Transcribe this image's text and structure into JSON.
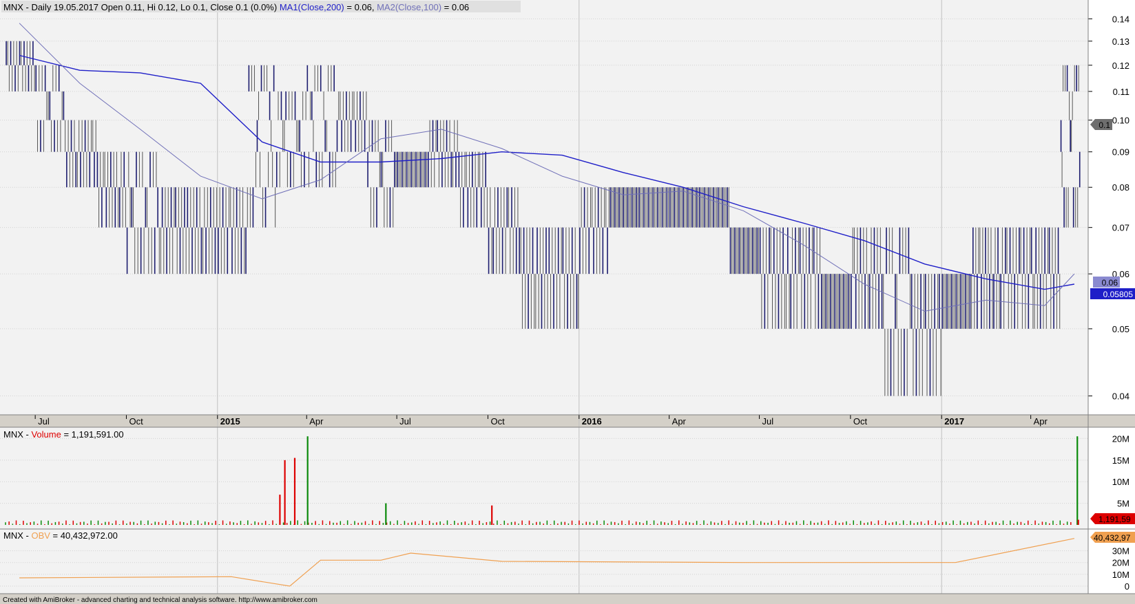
{
  "app": {
    "footer_text": "Created with AmiBroker - advanced charting and technical analysis software. http://www.amibroker.com"
  },
  "colors": {
    "chart_bg": "#f2f2f2",
    "panel_bg": "#ffffff",
    "grid": "#d2d2d2",
    "price_bar": "#1c1c6e",
    "price_bar_dim": "#555555",
    "ma1": "#1e1ec8",
    "ma2": "#7070b8",
    "vol_up": "#0a8a0a",
    "vol_down": "#dd0000",
    "obv": "#f0a050",
    "separator": "#a0a0a0",
    "footer_bg": "#d4d0c8"
  },
  "price_panel": {
    "title_parts": [
      {
        "text": "MNX - Daily 19.05.2017 Open 0.11, Hi 0.12, Lo 0.1, Close 0.1 (0.0%) ",
        "color": "#000000"
      },
      {
        "text": "MA1(Close,200)",
        "color": "#1e1ec8"
      },
      {
        "text": " = 0.06, ",
        "color": "#000000"
      },
      {
        "text": "MA2(Close,100)",
        "color": "#7070b8"
      },
      {
        "text": " = 0.06",
        "color": "#000000"
      }
    ],
    "y_ticks": [
      "0.14",
      "0.13",
      "0.12",
      "0.11",
      "0.10",
      "0.09",
      "0.08",
      "0.07",
      "0.06",
      "0.05",
      "0.04"
    ],
    "x_ticks": [
      {
        "label": "Jul",
        "bold": false
      },
      {
        "label": "Oct",
        "bold": false
      },
      {
        "label": "2015",
        "bold": true
      },
      {
        "label": "Apr",
        "bold": false
      },
      {
        "label": "Jul",
        "bold": false
      },
      {
        "label": "Oct",
        "bold": false
      },
      {
        "label": "2016",
        "bold": true
      },
      {
        "label": "Apr",
        "bold": false
      },
      {
        "label": "Jul",
        "bold": false
      },
      {
        "label": "Oct",
        "bold": false
      },
      {
        "label": "2017",
        "bold": true
      },
      {
        "label": "Apr",
        "bold": false
      }
    ],
    "price_badge": "0.1",
    "ma_badge_1": "0.06",
    "ma_badge_2": "0.05805"
  },
  "volume_panel": {
    "title_parts": [
      {
        "text": "MNX - ",
        "color": "#000000"
      },
      {
        "text": "Volume",
        "color": "#dd0000"
      },
      {
        "text": " = 1,191,591.00",
        "color": "#000000"
      }
    ],
    "y_ticks": [
      "20M",
      "15M",
      "10M",
      "5M"
    ],
    "badge": "1,191,59"
  },
  "obv_panel": {
    "title_parts": [
      {
        "text": "MNX - ",
        "color": "#000000"
      },
      {
        "text": "OBV",
        "color": "#f0a050"
      },
      {
        "text": " = 40,432,972.00",
        "color": "#000000"
      }
    ],
    "y_ticks": [
      "30M",
      "20M",
      "10M",
      "0"
    ],
    "badge": "40,432,97"
  },
  "chart_data": {
    "type": "bar",
    "series": [
      {
        "name": "MNX",
        "kind": "ohlc",
        "x": [
          "2014-06",
          "2014-07",
          "2014-08",
          "2014-09",
          "2014-10",
          "2014-11",
          "2014-12",
          "2015-01",
          "2015-02",
          "2015-03",
          "2015-04",
          "2015-05",
          "2015-06",
          "2015-07",
          "2015-08",
          "2015-09",
          "2015-10",
          "2015-11",
          "2015-12",
          "2016-01",
          "2016-02",
          "2016-03",
          "2016-04",
          "2016-05",
          "2016-06",
          "2016-07",
          "2016-08",
          "2016-09",
          "2016-10",
          "2016-11",
          "2016-12",
          "2017-01",
          "2017-02",
          "2017-03",
          "2017-04",
          "2017-05"
        ],
        "high": [
          0.13,
          0.12,
          0.1,
          0.09,
          0.09,
          0.08,
          0.08,
          0.08,
          0.12,
          0.11,
          0.12,
          0.11,
          0.1,
          0.09,
          0.1,
          0.09,
          0.08,
          0.07,
          0.07,
          0.08,
          0.08,
          0.08,
          0.08,
          0.08,
          0.07,
          0.07,
          0.07,
          0.06,
          0.07,
          0.07,
          0.06,
          0.06,
          0.07,
          0.07,
          0.07,
          0.12
        ],
        "low": [
          0.11,
          0.09,
          0.08,
          0.07,
          0.06,
          0.06,
          0.06,
          0.06,
          0.07,
          0.08,
          0.08,
          0.09,
          0.07,
          0.08,
          0.08,
          0.07,
          0.06,
          0.05,
          0.05,
          0.06,
          0.07,
          0.07,
          0.07,
          0.07,
          0.06,
          0.05,
          0.05,
          0.05,
          0.05,
          0.04,
          0.04,
          0.05,
          0.05,
          0.05,
          0.05,
          0.07
        ]
      },
      {
        "name": "MA1(Close,200)",
        "x": [
          "2014-06",
          "2014-08",
          "2014-10",
          "2014-12",
          "2015-02",
          "2015-04",
          "2015-06",
          "2015-08",
          "2015-10",
          "2015-12",
          "2016-02",
          "2016-04",
          "2016-06",
          "2016-08",
          "2016-10",
          "2016-12",
          "2017-02",
          "2017-04",
          "2017-05"
        ],
        "values": [
          0.124,
          0.118,
          0.117,
          0.113,
          0.093,
          0.087,
          0.087,
          0.088,
          0.09,
          0.089,
          0.084,
          0.08,
          0.075,
          0.071,
          0.067,
          0.062,
          0.059,
          0.057,
          0.058
        ]
      },
      {
        "name": "MA2(Close,100)",
        "x": [
          "2014-06",
          "2014-08",
          "2014-10",
          "2014-12",
          "2015-02",
          "2015-04",
          "2015-06",
          "2015-08",
          "2015-10",
          "2015-12",
          "2016-02",
          "2016-04",
          "2016-06",
          "2016-08",
          "2016-10",
          "2016-12",
          "2017-02",
          "2017-04",
          "2017-05"
        ],
        "values": [
          0.138,
          0.113,
          0.097,
          0.083,
          0.077,
          0.082,
          0.094,
          0.097,
          0.091,
          0.083,
          0.078,
          0.079,
          0.074,
          0.066,
          0.058,
          0.053,
          0.055,
          0.054,
          0.06
        ]
      },
      {
        "name": "Volume",
        "x": [
          "2015-03-05",
          "2015-03-10",
          "2015-03-20",
          "2015-04-02",
          "2015-06-20",
          "2015-10-05",
          "2017-05-18",
          "2017-05-19"
        ],
        "values": [
          7000000,
          15000000,
          15500000,
          20500000,
          5000000,
          4500000,
          20500000,
          1191591
        ]
      },
      {
        "name": "OBV",
        "x": [
          "2014-06",
          "2015-01",
          "2015-03",
          "2015-04",
          "2015-06",
          "2015-07",
          "2015-10",
          "2016-06",
          "2017-01",
          "2017-05"
        ],
        "values": [
          7000000,
          8000000,
          0,
          22000000,
          22000000,
          28000000,
          21000000,
          20000000,
          20000000,
          40432972
        ]
      }
    ],
    "ylim": [
      0.038,
      0.145
    ],
    "y_scale": "log",
    "grid": true
  }
}
